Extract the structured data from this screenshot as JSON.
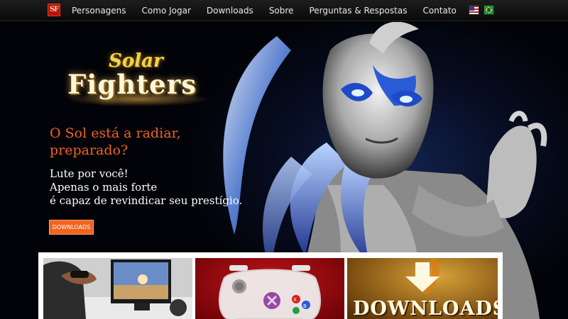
{
  "nav": {
    "logo_text": "SF",
    "items": [
      {
        "label": "Personagens"
      },
      {
        "label": "Como Jogar"
      },
      {
        "label": "Downloads"
      },
      {
        "label": "Sobre"
      },
      {
        "label": "Perguntas & Respostas"
      },
      {
        "label": "Contato"
      }
    ],
    "languages": [
      "english-flag",
      "brazil-flag"
    ]
  },
  "hero": {
    "logo": {
      "line1": "Solar",
      "line2": "Fighters"
    },
    "tagline": "O Sol está a radiar, preparado?",
    "subtext_lines": [
      "Lute por você!",
      "Apenas o mais forte",
      "é capaz de revindicar seu prestígio."
    ],
    "cta_label": "DOWNLOADS"
  },
  "features": [
    {
      "name": "gameplay-photo"
    },
    {
      "name": "controller-image"
    },
    {
      "name": "downloads-banner",
      "label": "DOWNLOADS"
    }
  ],
  "colors": {
    "accent": "#f0641e",
    "nav_bg": "#141414",
    "hero_bg": "#070d22"
  }
}
